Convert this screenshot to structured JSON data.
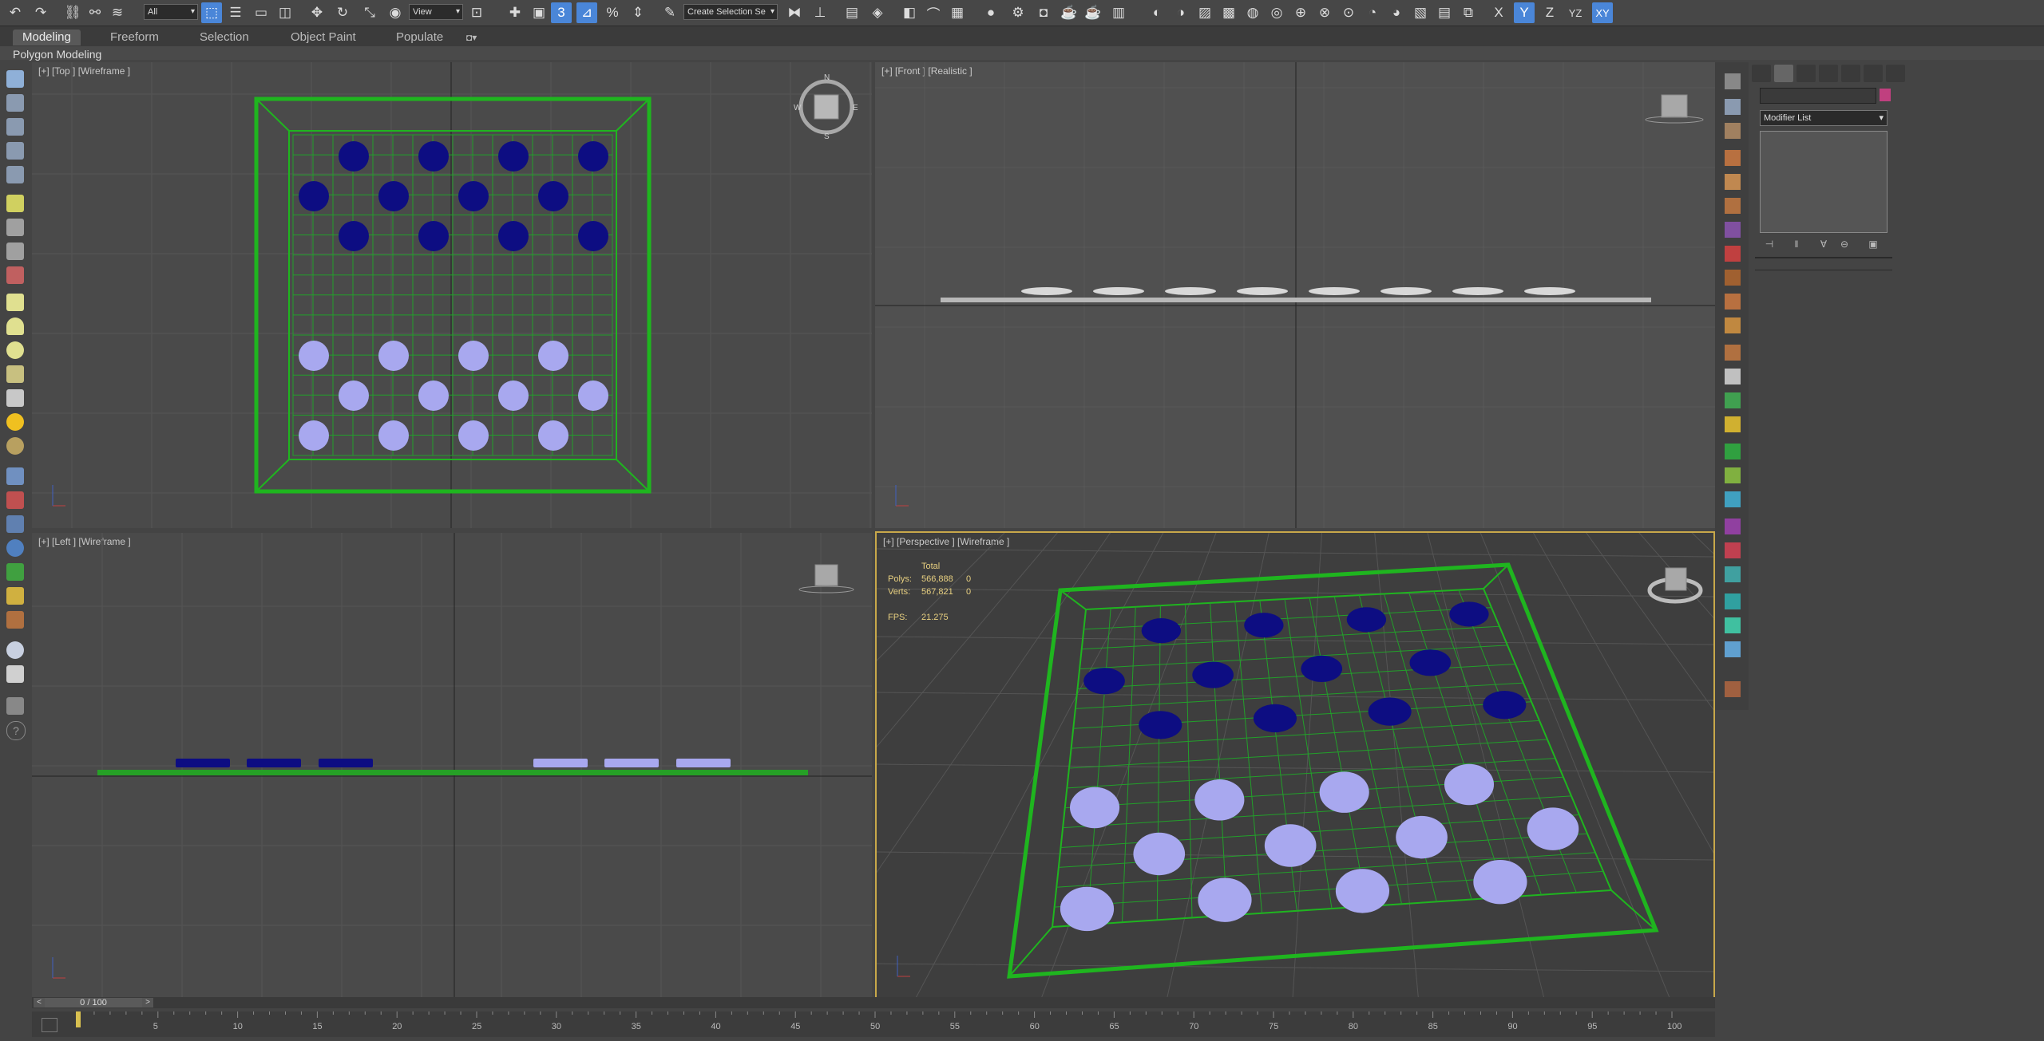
{
  "toolbar": {
    "selection_filter": "All",
    "reference_coord": "View",
    "named_selection": "Create Selection Se",
    "axis_x": "X",
    "axis_y": "Y",
    "axis_z": "Z",
    "axis_yz": "YZ",
    "axis_xy": "XY",
    "snap_label": "3",
    "angle_snap_label": "⊿",
    "percent_snap_label": "%",
    "accent": "#4a86d8"
  },
  "ribbon": {
    "tabs": [
      {
        "label": "Modeling",
        "active": true
      },
      {
        "label": "Freeform",
        "active": false
      },
      {
        "label": "Selection",
        "active": false
      },
      {
        "label": "Object Paint",
        "active": false
      },
      {
        "label": "Populate",
        "active": false
      }
    ],
    "panel_label": "Polygon Modeling"
  },
  "viewports": {
    "top": {
      "label": "[+] [Top ] [Wireframe ]",
      "viewcube_face": "TOP",
      "compass": [
        "N",
        "E",
        "S",
        "W"
      ]
    },
    "front": {
      "label": "[+] [Front ] [Realistic ]",
      "viewcube_face": "FRONT"
    },
    "left": {
      "label": "[+] [Left ] [Wireframe ]",
      "viewcube_face": "LEFT"
    },
    "perspective": {
      "label": "[+] [Perspective ] [Wireframe ]",
      "stats": {
        "header": "Total",
        "polys_label": "Polys:",
        "polys_value": "566,888",
        "polys_sel": "0",
        "verts_label": "Verts:",
        "verts_value": "567,821",
        "verts_sel": "0",
        "fps_label": "FPS:",
        "fps_value": "21.275"
      }
    }
  },
  "board": {
    "frame_color": "#1fb51f",
    "grid_color": "#22a02a",
    "dark_piece_color": "#0d0d82",
    "light_piece_color": "#a8a8ef"
  },
  "command_panel": {
    "modifier_list": "Modifier List",
    "name_value": "",
    "swatch_color": "#c0407f"
  },
  "timeline": {
    "slider_value": "0 / 100",
    "prev": "<",
    "next": ">",
    "ticks": [
      "5",
      "10",
      "15",
      "20",
      "25",
      "30",
      "35",
      "40",
      "45",
      "50",
      "55",
      "60",
      "65",
      "70",
      "75",
      "80",
      "85",
      "90",
      "95",
      "100"
    ]
  }
}
